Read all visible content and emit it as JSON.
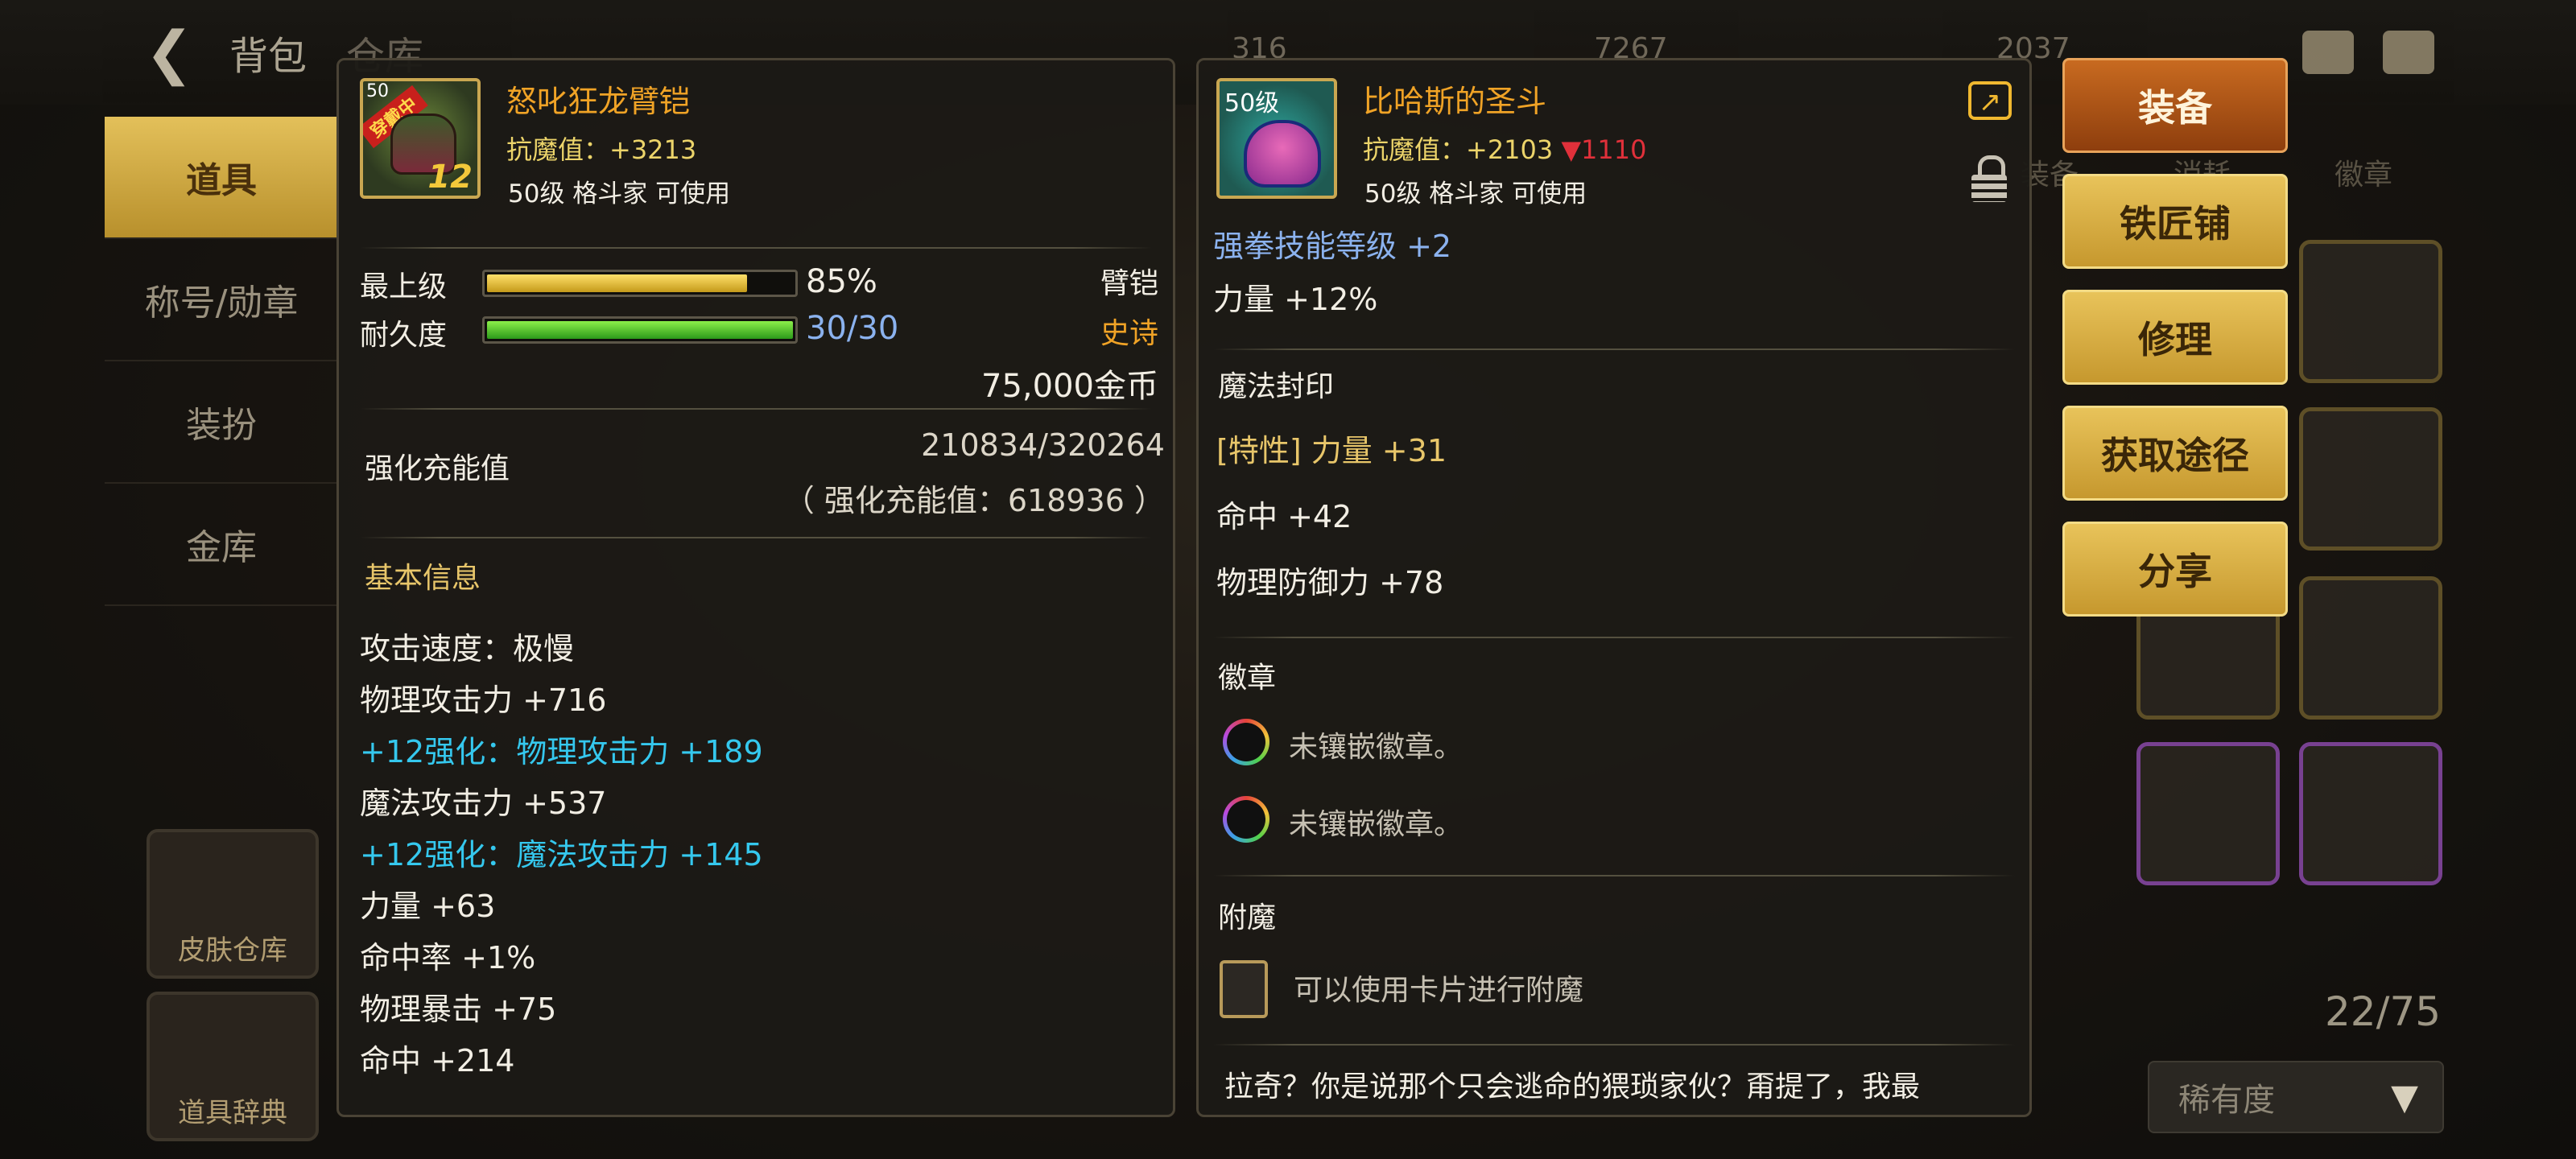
{
  "topbar": {
    "back_icon": "arrow-left-icon",
    "title": "背包",
    "title2": "仓库",
    "resources": [
      "316",
      "7267",
      "2037"
    ]
  },
  "left_tabs": [
    "道具",
    "称号/勋章",
    "装扮",
    "金库"
  ],
  "left_cards": [
    "皮肤仓库",
    "道具辞典"
  ],
  "inventory": {
    "tabs": [
      "装备",
      "消耗",
      "徽章"
    ],
    "count": "22/75",
    "filter": "稀有度"
  },
  "item1": {
    "name": "怒叱狂龙臂铠",
    "badge": "穿戴中",
    "level_tag": "50",
    "enhance_level": "12",
    "resist": "抗魔值：+3213",
    "req": "50级 格斗家 可使用",
    "grade_label": "最上级",
    "grade_pct_text": "85%",
    "grade_pct": 0.85,
    "type": "臂铠",
    "durability_label": "耐久度",
    "durability_text": "30/30",
    "durability_ratio": 1.0,
    "rarity": "史诗",
    "price": "75,000金币",
    "charge_label": "强化充能值",
    "charge_value": "210834/320264",
    "charge_total": "（ 强化充能值：618936 ）",
    "section_basic": "基本信息",
    "stats": [
      {
        "text": "攻击速度：极慢",
        "color": "white"
      },
      {
        "text": "物理攻击力 +716",
        "color": "white"
      },
      {
        "text": "+12强化：物理攻击力 +189",
        "color": "cyan"
      },
      {
        "text": "魔法攻击力 +537",
        "color": "white"
      },
      {
        "text": "+12强化：魔法攻击力 +145",
        "color": "cyan"
      },
      {
        "text": "力量 +63",
        "color": "white"
      },
      {
        "text": "命中率 +1%",
        "color": "white"
      },
      {
        "text": "物理暴击 +75",
        "color": "white"
      },
      {
        "text": "命中 +214",
        "color": "white"
      }
    ]
  },
  "item2": {
    "name": "比哈斯的圣斗",
    "level_tag": "50级",
    "resist": "抗魔值：+2103",
    "resist_diff": "▼1110",
    "req": "50级 格斗家 可使用",
    "skill_line": "强拳技能等级 +2",
    "str_line": "力量 +12%",
    "section_seal": "魔法封印",
    "seal_trait": "[特性] 力量 +31",
    "seal_lines": [
      "命中 +42",
      "物理防御力 +78"
    ],
    "section_emblem": "徽章",
    "emblem_empty": [
      "未镶嵌徽章。",
      "未镶嵌徽章。"
    ],
    "section_enchant": "附魔",
    "enchant_text": "可以使用卡片进行附魔",
    "flavor": "拉奇？你是说那个只会逃命的猥琐家伙？甭提了，我最"
  },
  "buttons": [
    "装备",
    "铁匠铺",
    "修理",
    "获取途径",
    "分享"
  ],
  "colors": {
    "accent_gold": "#e8c35a",
    "primary_button": "#c86a20",
    "item_name": "#f0a326",
    "enhance_cyan": "#35c8ee",
    "epic": "#f0a326",
    "negative": "#e0303a"
  }
}
